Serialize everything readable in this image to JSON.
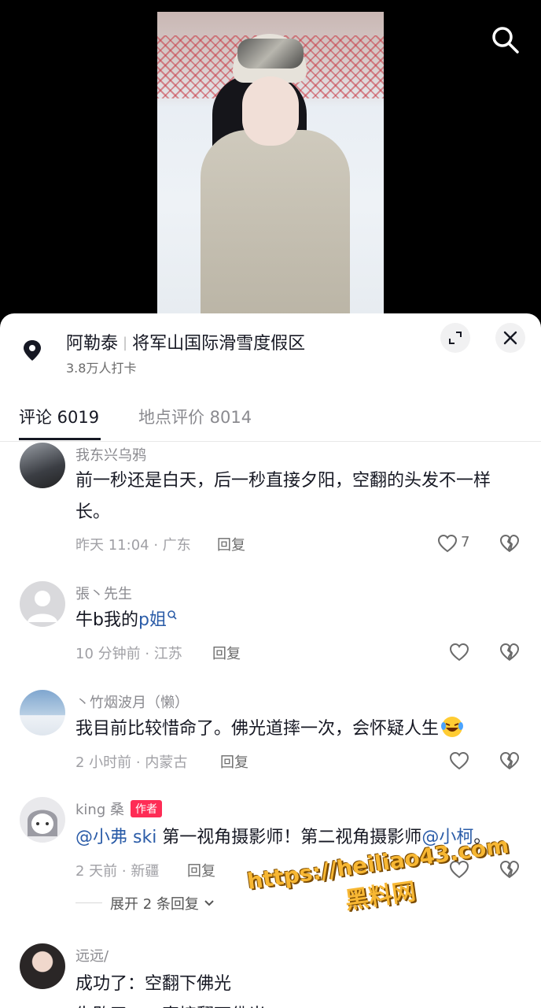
{
  "location": {
    "region": "阿勒泰",
    "name": "将军山国际滑雪度假区",
    "checkins": "3.8万人打卡"
  },
  "tabs": [
    {
      "label": "评论 6019"
    },
    {
      "label": "地点评价 8014"
    }
  ],
  "comments": [
    {
      "username": "我东兴乌鸦",
      "text": "前一秒还是白天，后一秒直接夕阳，空翻的头发不一样长。",
      "time": "昨天 11:04 · 广东",
      "reply": "回复",
      "likes": "7"
    },
    {
      "username": "張丶先生",
      "text": "牛b我的",
      "link": "p姐",
      "time": "10 分钟前 · 江苏",
      "reply": "回复",
      "likes": ""
    },
    {
      "username": "丶竹烟波月（懒）",
      "text": "我目前比较惜命了。佛光道摔一次，会怀疑人生",
      "time": "2 小时前 · 内蒙古",
      "reply": "回复",
      "likes": ""
    },
    {
      "username": "king 桑",
      "badge": "作者",
      "mention1": "@小弗 ski",
      "mid": " 第一视角摄影师！第二视角摄影师",
      "mention2": "@小柯",
      "end": "。",
      "time": "2 天前 · 新疆",
      "reply": "回复",
      "expand": "展开 2 条回复"
    },
    {
      "username": "远远/",
      "text": "成功了：空翻下佛光",
      "partial": "失败了……直接翻下佛光"
    }
  ],
  "watermark": {
    "url": "https://heiliao43.com",
    "name": "黑料网"
  },
  "colors": {
    "accent": "#fe2c55",
    "mention": "#2b5ca8",
    "watermark": "#f7b733"
  }
}
